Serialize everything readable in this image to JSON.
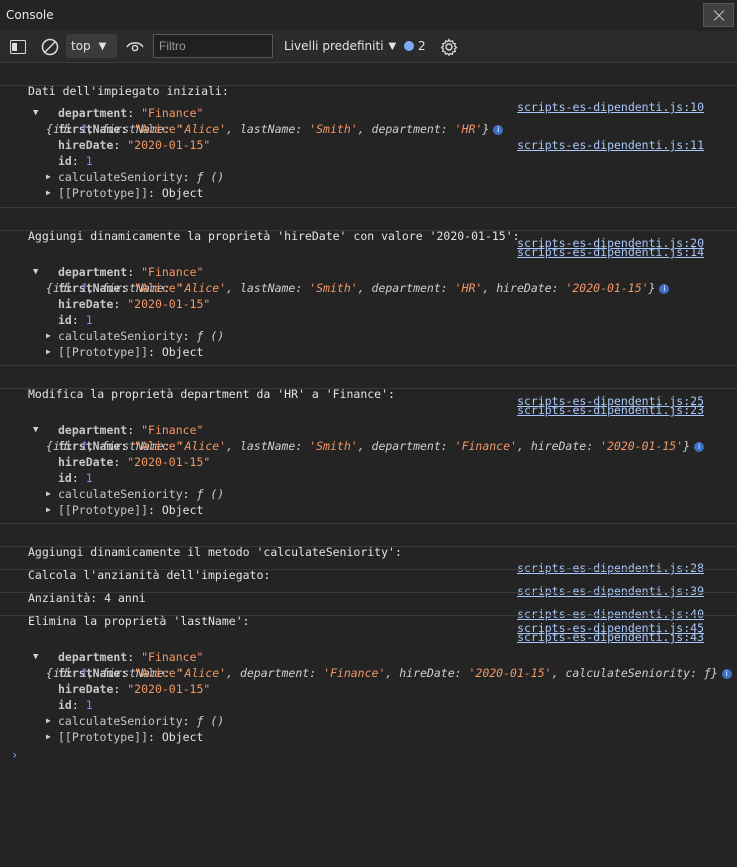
{
  "window": {
    "title": "Console"
  },
  "toolbar": {
    "context": "top",
    "filter_placeholder": "Filtro",
    "levels": "Livelli predefiniti",
    "issues_count": "2"
  },
  "messages": [
    {
      "text": "Dati dell'impiegato iniziali:",
      "source": "scripts-es-dipendenti.js:10"
    },
    {
      "source": "scripts-es-dipendenti.js:11",
      "preview": [
        "{",
        "id",
        ": ",
        "1",
        ", ",
        "firstName",
        ": ",
        "'Alice'",
        ", ",
        "lastName",
        ": ",
        "'Smith'",
        ", ",
        "department",
        ": ",
        "'HR'",
        "}"
      ],
      "props": [
        {
          "key": "department",
          "sep": ": ",
          "value": "\"Finance\""
        },
        {
          "key": "firstName",
          "sep": ": ",
          "value": "\"Alice\""
        },
        {
          "key": "hireDate",
          "sep": ": ",
          "value": "\"2020-01-15\""
        },
        {
          "key": "id",
          "sep": ": ",
          "value": "1"
        },
        {
          "key": "calculateSeniority",
          "sep": ": ",
          "value": "ƒ ()"
        },
        {
          "key": "[[Prototype]]",
          "sep": ": ",
          "value": "Object"
        }
      ]
    },
    {
      "text": "Aggiungi dinamicamente la proprietà 'hireDate' con valore '2020-01-15':",
      "source": "scripts-es-dipendenti.js:14"
    },
    {
      "source": "scripts-es-dipendenti.js:20",
      "preview": [
        "{",
        "id",
        ": ",
        "1",
        ", ",
        "firstName",
        ": ",
        "'Alice'",
        ", ",
        "lastName",
        ": ",
        "'Smith'",
        ", ",
        "department",
        ": ",
        "'HR'",
        ", ",
        "hireDate",
        ": ",
        "'2020-01-15'",
        "}"
      ],
      "props": [
        {
          "key": "department",
          "sep": ": ",
          "value": "\"Finance\""
        },
        {
          "key": "firstName",
          "sep": ": ",
          "value": "\"Alice\""
        },
        {
          "key": "hireDate",
          "sep": ": ",
          "value": "\"2020-01-15\""
        },
        {
          "key": "id",
          "sep": ": ",
          "value": "1"
        },
        {
          "key": "calculateSeniority",
          "sep": ": ",
          "value": "ƒ ()"
        },
        {
          "key": "[[Prototype]]",
          "sep": ": ",
          "value": "Object"
        }
      ]
    },
    {
      "text": "Modifica la proprietà department da 'HR' a 'Finance':",
      "source": "scripts-es-dipendenti.js:23"
    },
    {
      "source": "scripts-es-dipendenti.js:25",
      "preview": [
        "{",
        "id",
        ": ",
        "1",
        ", ",
        "firstName",
        ": ",
        "'Alice'",
        ", ",
        "lastName",
        ": ",
        "'Smith'",
        ", ",
        "department",
        ": ",
        "'Finance'",
        ", ",
        "hireDate",
        ": ",
        "'2020-01-15'",
        "}"
      ],
      "props": [
        {
          "key": "department",
          "sep": ": ",
          "value": "\"Finance\""
        },
        {
          "key": "firstName",
          "sep": ": ",
          "value": "\"Alice\""
        },
        {
          "key": "hireDate",
          "sep": ": ",
          "value": "\"2020-01-15\""
        },
        {
          "key": "id",
          "sep": ": ",
          "value": "1"
        },
        {
          "key": "calculateSeniority",
          "sep": ": ",
          "value": "ƒ ()"
        },
        {
          "key": "[[Prototype]]",
          "sep": ": ",
          "value": "Object"
        }
      ]
    },
    {
      "text": "Aggiungi dinamicamente il metodo 'calculateSeniority':",
      "source": "scripts-es-dipendenti.js:28"
    },
    {
      "text": "Calcola l'anzianità dell'impiegato:",
      "source": "scripts-es-dipendenti.js:39"
    },
    {
      "text": "Anzianità: 4 anni",
      "source": "scripts-es-dipendenti.js:40"
    },
    {
      "text": "Elimina la proprietà 'lastName':",
      "source": "scripts-es-dipendenti.js:43"
    },
    {
      "source": "scripts-es-dipendenti.js:45",
      "preview": [
        "{",
        "id",
        ": ",
        "1",
        ", ",
        "firstName",
        ": ",
        "'Alice'",
        ", ",
        "department",
        ": ",
        "'Finance'",
        ", ",
        "hireDate",
        ": ",
        "'2020-01-15'",
        ", ",
        "calculateSeniority",
        ": ",
        "ƒ",
        "}"
      ],
      "props": [
        {
          "key": "department",
          "sep": ": ",
          "value": "\"Finance\""
        },
        {
          "key": "firstName",
          "sep": ": ",
          "value": "\"Alice\""
        },
        {
          "key": "hireDate",
          "sep": ": ",
          "value": "\"2020-01-15\""
        },
        {
          "key": "id",
          "sep": ": ",
          "value": "1"
        },
        {
          "key": "calculateSeniority",
          "sep": ": ",
          "value": "ƒ ()"
        },
        {
          "key": "[[Prototype]]",
          "sep": ": ",
          "value": "Object"
        }
      ]
    }
  ],
  "prompt": "›",
  "colors": {
    "link": "#a8c7fa",
    "number": "#9980ff",
    "string": "#f29766",
    "background": "#242424"
  }
}
